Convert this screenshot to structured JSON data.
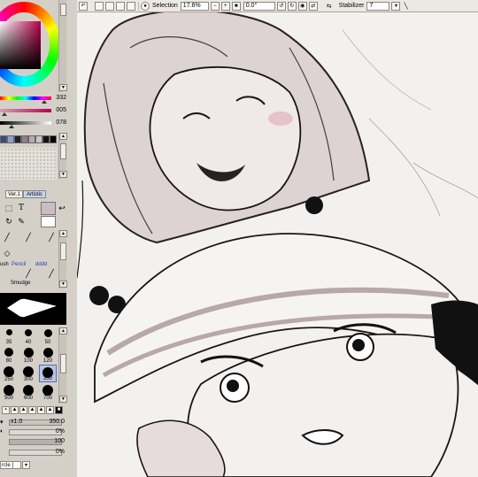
{
  "colors": {
    "accent": "#b8004a",
    "selected_color": "#c9bcc2",
    "canvas_bg": "#f3f1ef",
    "line": "#1a1416",
    "skin_tone": "#d9cccf"
  },
  "color_sliders": [
    {
      "value": "332",
      "color": "hue"
    },
    {
      "value": "005",
      "color": "#b8004a"
    },
    {
      "value": "078",
      "color": "gray"
    }
  ],
  "toolbar": {
    "selection_label": "Selection",
    "zoom": "17.6%",
    "rotation": "0.0°",
    "stabilizer_label": "Stabilizer",
    "stabilizer_value": "7"
  },
  "tool_tabs": {
    "ver": "Ver.1",
    "artistic": "Artistic"
  },
  "tools": {
    "text_icon": "T",
    "brush_label": "ush",
    "pencil_label": "Pencil",
    "custom_label": "dddd",
    "smudge_label": "Smudge"
  },
  "brush_sizes": [
    {
      "label": "35"
    },
    {
      "label": "40"
    },
    {
      "label": "50"
    },
    {
      "label": "80"
    },
    {
      "label": "100"
    },
    {
      "label": "120"
    },
    {
      "label": "250"
    },
    {
      "label": "300"
    },
    {
      "label": "350"
    },
    {
      "label": "500"
    },
    {
      "label": "600"
    },
    {
      "label": "700"
    }
  ],
  "brush_params": {
    "size_multiplier": "x1.0",
    "size": "350.0",
    "density1": "0%",
    "density2": "100",
    "density3": "0%"
  },
  "shape_select": {
    "value": "rcle ]"
  }
}
